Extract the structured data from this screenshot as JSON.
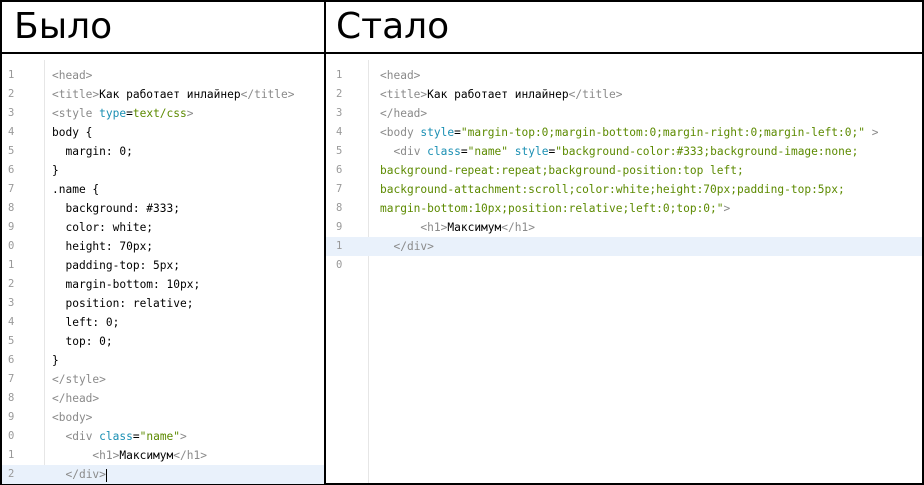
{
  "left_panel": {
    "title": "Было",
    "line_numbers": [
      "1",
      "2",
      "3",
      "4",
      "5",
      "6",
      "7",
      "8",
      "9",
      "0",
      "1",
      "2",
      "3",
      "4",
      "5",
      "6",
      "7",
      "8",
      "9",
      "0",
      "1",
      "2"
    ],
    "lines": [
      {
        "indent": "",
        "parts": [
          {
            "c": "tag",
            "t": "<head>"
          }
        ]
      },
      {
        "indent": "",
        "parts": [
          {
            "c": "tag",
            "t": "<title>"
          },
          {
            "c": "txtc",
            "t": "Как работает инлайнер"
          },
          {
            "c": "tag",
            "t": "</title>"
          }
        ]
      },
      {
        "indent": "",
        "parts": [
          {
            "c": "tag",
            "t": "<style "
          },
          {
            "c": "attr",
            "t": "type"
          },
          {
            "c": "txtc",
            "t": "="
          },
          {
            "c": "val",
            "t": "text/css"
          },
          {
            "c": "tag",
            "t": ">"
          }
        ]
      },
      {
        "indent": "",
        "parts": [
          {
            "c": "txtc",
            "t": "body {"
          }
        ]
      },
      {
        "indent": "  ",
        "parts": [
          {
            "c": "txtc",
            "t": "margin: 0;"
          }
        ]
      },
      {
        "indent": "",
        "parts": [
          {
            "c": "txtc",
            "t": "}"
          }
        ]
      },
      {
        "indent": "",
        "parts": [
          {
            "c": "txtc",
            "t": ".name {"
          }
        ]
      },
      {
        "indent": "  ",
        "parts": [
          {
            "c": "txtc",
            "t": "background: #333;"
          }
        ]
      },
      {
        "indent": "  ",
        "parts": [
          {
            "c": "txtc",
            "t": "color: white;"
          }
        ]
      },
      {
        "indent": "  ",
        "parts": [
          {
            "c": "txtc",
            "t": "height: 70px;"
          }
        ]
      },
      {
        "indent": "  ",
        "parts": [
          {
            "c": "txtc",
            "t": "padding-top: 5px;"
          }
        ]
      },
      {
        "indent": "  ",
        "parts": [
          {
            "c": "txtc",
            "t": "margin-bottom: 10px;"
          }
        ]
      },
      {
        "indent": "  ",
        "parts": [
          {
            "c": "txtc",
            "t": "position: relative;"
          }
        ]
      },
      {
        "indent": "  ",
        "parts": [
          {
            "c": "txtc",
            "t": "left: 0;"
          }
        ]
      },
      {
        "indent": "  ",
        "parts": [
          {
            "c": "txtc",
            "t": "top: 0;"
          }
        ]
      },
      {
        "indent": "",
        "parts": [
          {
            "c": "txtc",
            "t": "}"
          }
        ]
      },
      {
        "indent": "",
        "parts": [
          {
            "c": "tag",
            "t": "</style>"
          }
        ]
      },
      {
        "indent": "",
        "parts": [
          {
            "c": "tag",
            "t": "</head>"
          }
        ]
      },
      {
        "indent": "",
        "parts": [
          {
            "c": "tag",
            "t": "<body>"
          }
        ]
      },
      {
        "indent": "  ",
        "parts": [
          {
            "c": "tag",
            "t": "<div "
          },
          {
            "c": "attr",
            "t": "class"
          },
          {
            "c": "txtc",
            "t": "="
          },
          {
            "c": "val",
            "t": "\"name\""
          },
          {
            "c": "tag",
            "t": ">"
          }
        ]
      },
      {
        "indent": "      ",
        "parts": [
          {
            "c": "tag",
            "t": "<h1>"
          },
          {
            "c": "txtc",
            "t": "Максимум"
          },
          {
            "c": "tag",
            "t": "</h1>"
          }
        ]
      },
      {
        "indent": "  ",
        "parts": [
          {
            "c": "tag",
            "t": "</div>"
          }
        ],
        "highlight": true,
        "cursor": true
      }
    ]
  },
  "right_panel": {
    "title": "Стало",
    "line_numbers": [
      "1",
      "2",
      "3",
      "4",
      "5",
      "6",
      "7",
      "8",
      "9",
      "1",
      "0"
    ],
    "lines": [
      {
        "indent": "",
        "parts": [
          {
            "c": "tag",
            "t": "<head>"
          }
        ]
      },
      {
        "indent": "",
        "parts": [
          {
            "c": "tag",
            "t": "<title>"
          },
          {
            "c": "txtc",
            "t": "Как работает инлайнер"
          },
          {
            "c": "tag",
            "t": "</title>"
          }
        ]
      },
      {
        "indent": "",
        "parts": [
          {
            "c": "tag",
            "t": "</head>"
          }
        ]
      },
      {
        "indent": "",
        "parts": [
          {
            "c": "tag",
            "t": "<body "
          },
          {
            "c": "attr",
            "t": "style"
          },
          {
            "c": "txtc",
            "t": "="
          },
          {
            "c": "val",
            "t": "\"margin-top:0;margin-bottom:0;margin-right:0;margin-left:0;\""
          },
          {
            "c": "tag",
            "t": " >"
          }
        ]
      },
      {
        "indent": "  ",
        "parts": [
          {
            "c": "tag",
            "t": "<div "
          },
          {
            "c": "attr",
            "t": "class"
          },
          {
            "c": "txtc",
            "t": "="
          },
          {
            "c": "val",
            "t": "\"name\""
          },
          {
            "c": "txtc",
            "t": " "
          },
          {
            "c": "attr",
            "t": "style"
          },
          {
            "c": "txtc",
            "t": "="
          },
          {
            "c": "val",
            "t": "\"background-color:#333;background-image:none;"
          }
        ]
      },
      {
        "indent": "",
        "wrap": true,
        "parts": [
          {
            "c": "val",
            "t": "background-repeat:repeat;background-position:top left;"
          }
        ]
      },
      {
        "indent": "",
        "wrap": true,
        "parts": [
          {
            "c": "val",
            "t": "background-attachment:scroll;color:white;height:70px;padding-top:5px;"
          }
        ]
      },
      {
        "indent": "",
        "wrap": true,
        "parts": [
          {
            "c": "val",
            "t": "margin-bottom:10px;position:relative;left:0;top:0;\""
          },
          {
            "c": "tag",
            "t": ">"
          }
        ]
      },
      {
        "indent": "      ",
        "parts": [
          {
            "c": "tag",
            "t": "<h1>"
          },
          {
            "c": "txtc",
            "t": "Максимум"
          },
          {
            "c": "tag",
            "t": "</h1>"
          }
        ]
      },
      {
        "indent": "  ",
        "parts": [
          {
            "c": "tag",
            "t": "</div>"
          }
        ],
        "highlight": true
      },
      {
        "indent": "",
        "parts": []
      }
    ]
  }
}
